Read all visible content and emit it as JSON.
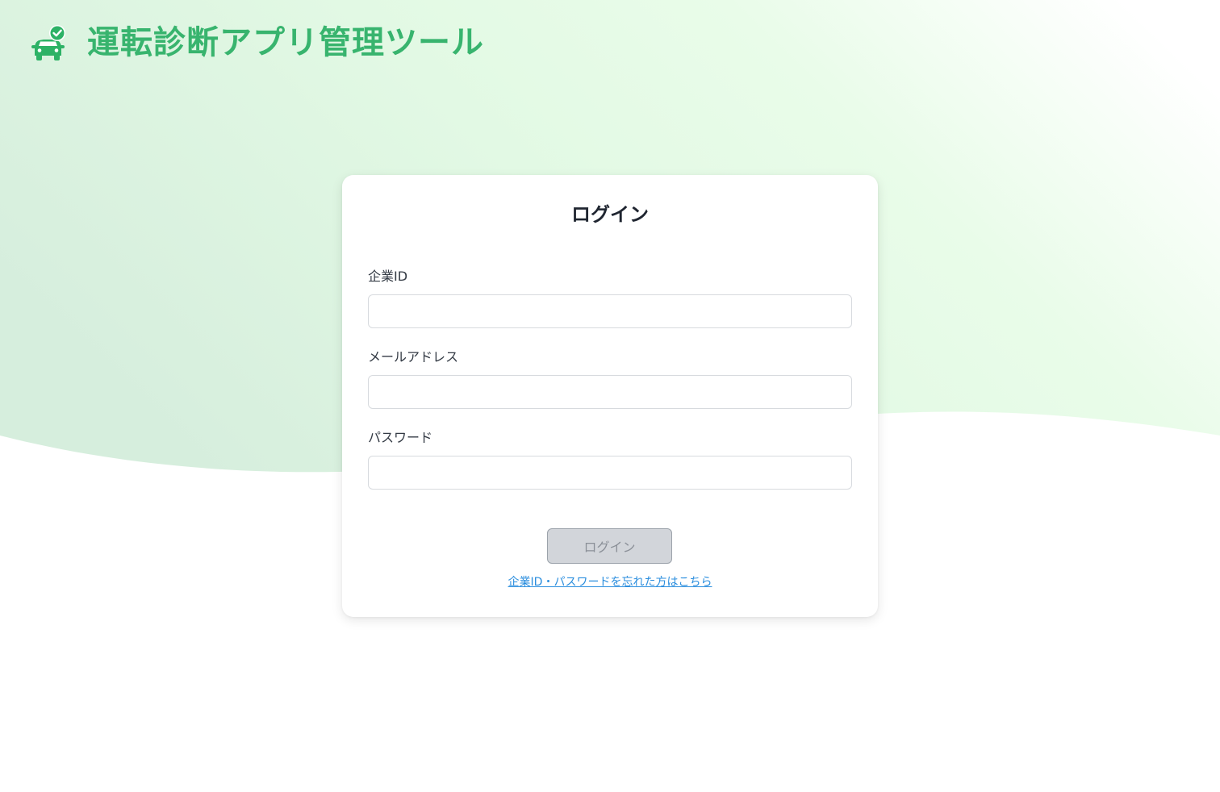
{
  "header": {
    "logo_icon": "car-check-icon",
    "app_title": "運転診断アプリ管理ツール"
  },
  "login_form": {
    "title": "ログイン",
    "fields": [
      {
        "label": "企業ID",
        "value": "",
        "placeholder": ""
      },
      {
        "label": "メールアドレス",
        "value": "",
        "placeholder": ""
      },
      {
        "label": "パスワード",
        "value": "",
        "placeholder": ""
      }
    ],
    "submit_label": "ログイン",
    "forgot_link": "企業ID・パスワードを忘れた方はこちら"
  },
  "colors": {
    "brand_green": "#38b46e",
    "background_gradient_left": "#d6eedd",
    "background_gradient_right": "#ffffff",
    "link_blue": "#2b8ede",
    "disabled_button_bg": "#d2d5da"
  }
}
